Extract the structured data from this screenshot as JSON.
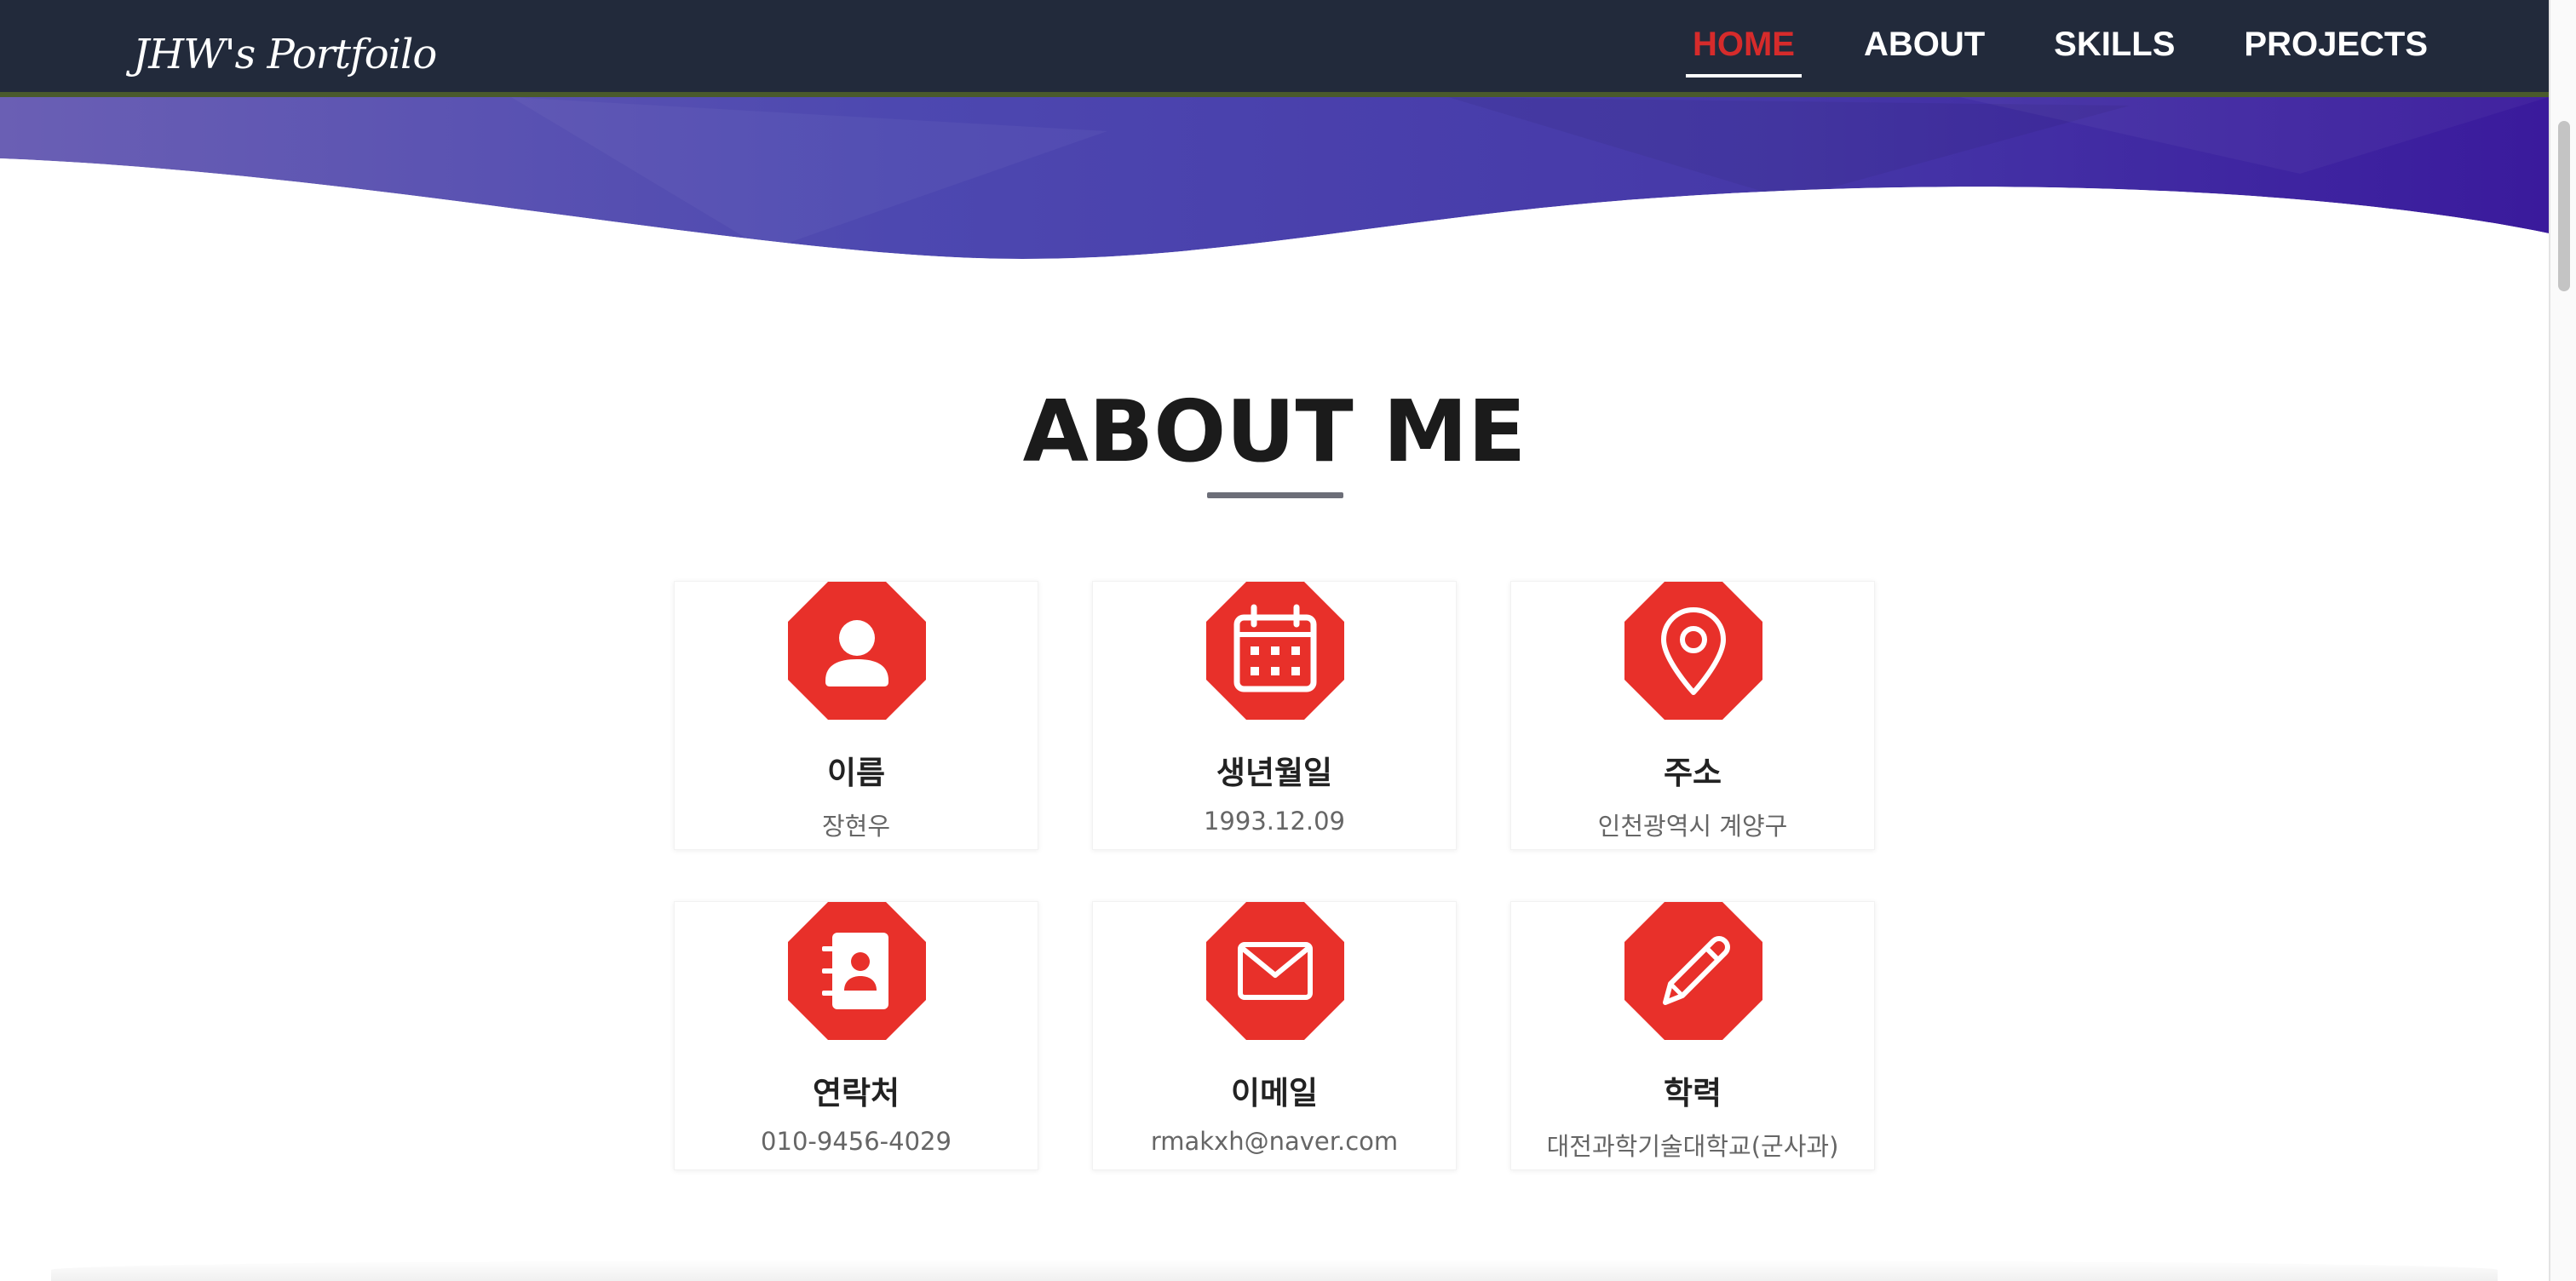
{
  "navbar": {
    "brand": "JHW's Portfoilo",
    "items": [
      {
        "label": "HOME",
        "active": true
      },
      {
        "label": "ABOUT",
        "active": false
      },
      {
        "label": "SKILLS",
        "active": false
      },
      {
        "label": "PROJECTS",
        "active": false
      }
    ]
  },
  "about": {
    "title": "ABOUT ME",
    "cards": [
      {
        "icon": "person-icon",
        "label": "이름",
        "value": "장현우"
      },
      {
        "icon": "calendar-icon",
        "label": "생년월일",
        "value": "1993.12.09"
      },
      {
        "icon": "location-pin-icon",
        "label": "주소",
        "value": "인천광역시 계양구"
      },
      {
        "icon": "contact-book-icon",
        "label": "연락처",
        "value": "010-9456-4029"
      },
      {
        "icon": "envelope-icon",
        "label": "이메일",
        "value": "rmakxh@naver.com"
      },
      {
        "icon": "pencil-icon",
        "label": "학력",
        "value": "대전과학기술대학교(군사과)"
      }
    ]
  },
  "colors": {
    "navbar_bg": "#222a3b",
    "accent_red": "#e8302a",
    "active_nav": "#d62b2b",
    "hero_gradient_start": "#6a5fb4",
    "hero_gradient_end": "#3a1a9c"
  }
}
